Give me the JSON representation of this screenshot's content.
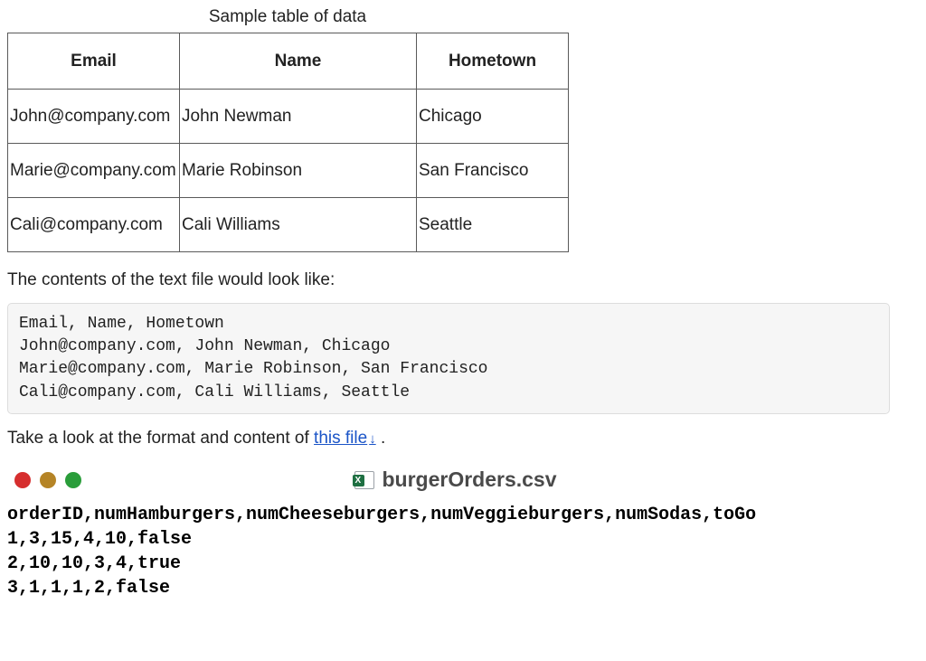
{
  "caption": "Sample table of data",
  "headers": [
    "Email",
    "Name",
    "Hometown"
  ],
  "rows": [
    [
      "John@company.com",
      "John Newman",
      "Chicago"
    ],
    [
      "Marie@company.com",
      "Marie Robinson",
      "San Francisco"
    ],
    [
      "Cali@company.com",
      "Cali Williams",
      "Seattle"
    ]
  ],
  "intro_line": "The contents of the text file would look like:",
  "code_lines": [
    "Email, Name, Hometown",
    "John@company.com, John Newman, Chicago",
    "Marie@company.com, Marie Robinson, San Francisco",
    "Cali@company.com, Cali Williams, Seattle"
  ],
  "link_prefix": "Take a look at the format and content of ",
  "link_text": "this file",
  "link_suffix": " .",
  "window_title": "burgerOrders.csv",
  "csv_lines": [
    "orderID,numHamburgers,numCheeseburgers,numVeggieburgers,numSodas,toGo",
    "1,3,15,4,10,false",
    "2,10,10,3,4,true",
    "3,1,1,1,2,false"
  ]
}
